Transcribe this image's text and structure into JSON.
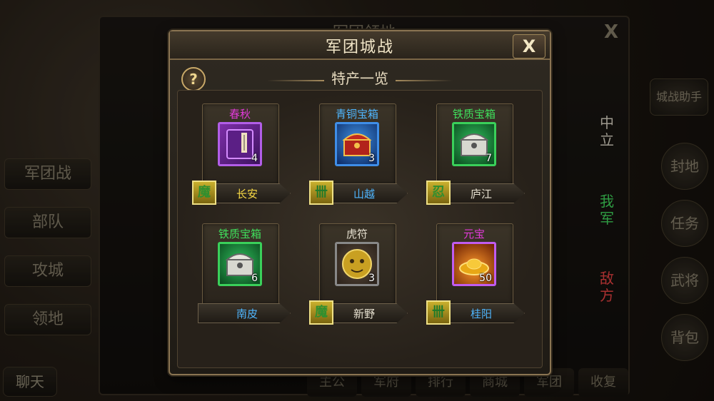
{
  "background": {
    "panel_title": "军团领地",
    "close_label": "X",
    "left_buttons": [
      "军团战",
      "部队",
      "攻城",
      "领地"
    ],
    "right_buttons": [
      "城战助手",
      "封地",
      "任务",
      "武将",
      "背包"
    ],
    "side_tabs": [
      "中立",
      "我军",
      "敌方"
    ],
    "bottom_buttons": [
      "主公",
      "军府",
      "排行",
      "商城",
      "军团",
      "收复"
    ],
    "chat_label": "聊天"
  },
  "modal": {
    "title": "军团城战",
    "close_label": "X",
    "help_label": "?",
    "section_title": "特产一览"
  },
  "items": [
    {
      "name": "春秋",
      "name_color": "#e23ad9",
      "count": "4",
      "city": "长安",
      "badge": "魔",
      "badge_color": "#2f8f2f",
      "icon": "book-icon"
    },
    {
      "name": "青铜宝箱",
      "name_color": "#4fb6ff",
      "count": "3",
      "city": "山越",
      "badge": "卌",
      "badge_color": "#1f7a2a",
      "icon": "bronze-chest-icon"
    },
    {
      "name": "铁质宝箱",
      "name_color": "#3fe05c",
      "count": "7",
      "city": "庐江",
      "badge": "忍",
      "badge_color": "#2f8f2f",
      "icon": "iron-chest-icon"
    },
    {
      "name": "铁质宝箱",
      "name_color": "#3fe05c",
      "count": "6",
      "city": "南皮",
      "badge": "",
      "badge_color": "",
      "icon": "iron-chest-icon"
    },
    {
      "name": "虎符",
      "name_color": "#e6e0d0",
      "count": "3",
      "city": "新野",
      "badge": "魔",
      "badge_color": "#2f8f2f",
      "icon": "tiger-tally-icon"
    },
    {
      "name": "元宝",
      "name_color": "#e23ad9",
      "count": "50",
      "city": "桂阳",
      "badge": "卌",
      "badge_color": "#1f7a2a",
      "icon": "gold-ingot-icon"
    }
  ]
}
